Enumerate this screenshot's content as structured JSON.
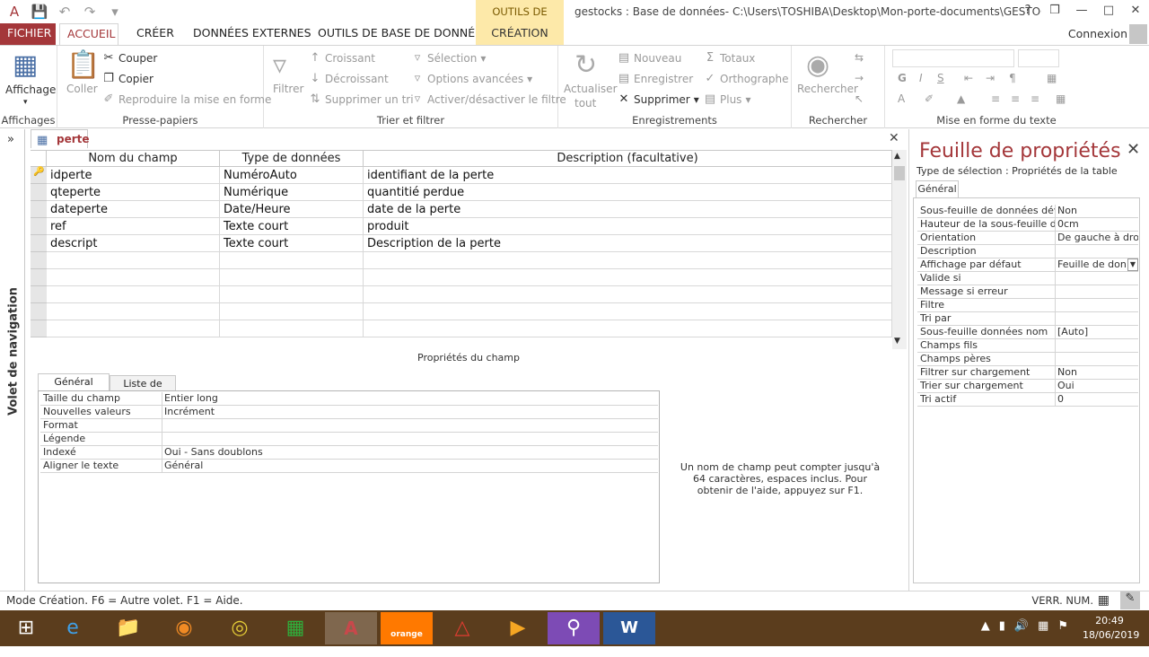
{
  "titlebar": {
    "context_header": "OUTILS DE TABLE",
    "window_title": "gestocks : Base de données- C:\\Users\\TOSHIBA\\Desktop\\Mon-porte-documents\\GESTOCK\\ge...",
    "help": "?",
    "restore": "❒",
    "minimize": "—",
    "maximize": "□",
    "close": "✕"
  },
  "tabs": {
    "file": "FICHIER",
    "accueil": "ACCUEIL",
    "creer": "CRÉER",
    "donnees_externes": "DONNÉES EXTERNES",
    "outils_bd": "OUTILS DE BASE DE DONNÉES",
    "creation": "CRÉATION",
    "connexion": "Connexion"
  },
  "ribbon": {
    "affichage": {
      "label": "Affichage",
      "group": "Affichages"
    },
    "clipboard": {
      "coller": "Coller",
      "couper": "Couper",
      "copier": "Copier",
      "reproduire": "Reproduire la mise en forme",
      "group": "Presse-papiers"
    },
    "sort": {
      "filtrer": "Filtrer",
      "croissant": "Croissant",
      "decroissant": "Décroissant",
      "supprimer_tri": "Supprimer un tri",
      "selection": "Sélection",
      "options": "Options avancées",
      "activer": "Activer/désactiver le filtre",
      "group": "Trier et filtrer"
    },
    "records": {
      "actualiser": "Actualiser",
      "tout": "tout",
      "nouveau": "Nouveau",
      "enregistrer": "Enregistrer",
      "supprimer": "Supprimer",
      "totaux": "Totaux",
      "orthographe": "Orthographe",
      "plus": "Plus",
      "group": "Enregistrements"
    },
    "find": {
      "rechercher": "Rechercher",
      "group": "Rechercher"
    },
    "text": {
      "group": "Mise en forme du texte",
      "bold": "G",
      "italic": "I",
      "underline": "S"
    }
  },
  "nav": {
    "label": "Volet de navigation",
    "toggle": "»"
  },
  "document": {
    "tab_label": "perte",
    "close": "✕",
    "headers": [
      "Nom du champ",
      "Type de données",
      "Description (facultative)"
    ],
    "rows": [
      {
        "name": "idperte",
        "type": "NuméroAuto",
        "desc": "identifiant de la perte"
      },
      {
        "name": "qteperte",
        "type": "Numérique",
        "desc": "quantitié perdue"
      },
      {
        "name": "dateperte",
        "type": "Date/Heure",
        "desc": "date de la perte"
      },
      {
        "name": "ref",
        "type": "Texte court",
        "desc": "produit"
      },
      {
        "name": "descript",
        "type": "Texte court",
        "desc": "Description de la perte"
      }
    ]
  },
  "field_props": {
    "title": "Propriétés du champ",
    "tab_general": "Général",
    "tab_lookup": "Liste de choix",
    "rows": [
      {
        "label": "Taille du champ",
        "value": "Entier long"
      },
      {
        "label": "Nouvelles valeurs",
        "value": "Incrément"
      },
      {
        "label": "Format",
        "value": ""
      },
      {
        "label": "Légende",
        "value": ""
      },
      {
        "label": "Indexé",
        "value": "Oui - Sans doublons"
      },
      {
        "label": "Aligner le texte",
        "value": "Général"
      }
    ],
    "help": "Un nom de champ peut compter jusqu'à 64 caractères, espaces inclus. Pour obtenir de l'aide, appuyez sur F1."
  },
  "property_sheet": {
    "title": "Feuille de propriétés",
    "close": "✕",
    "selection_type": "Type de sélection :  Propriétés de la table",
    "tab": "Général",
    "rows": [
      {
        "label": "Sous-feuille de données développée",
        "value": "Non"
      },
      {
        "label": "Hauteur de la sous-feuille de données",
        "value": "0cm"
      },
      {
        "label": "Orientation",
        "value": "De gauche à droite"
      },
      {
        "label": "Description",
        "value": ""
      },
      {
        "label": "Affichage par défaut",
        "value": "Feuille de données"
      },
      {
        "label": "Valide si",
        "value": ""
      },
      {
        "label": "Message si erreur",
        "value": ""
      },
      {
        "label": "Filtre",
        "value": ""
      },
      {
        "label": "Tri par",
        "value": ""
      },
      {
        "label": "Sous-feuille données nom",
        "value": "[Auto]"
      },
      {
        "label": "Champs fils",
        "value": ""
      },
      {
        "label": "Champs pères",
        "value": ""
      },
      {
        "label": "Filtrer sur chargement",
        "value": "Non"
      },
      {
        "label": "Trier sur chargement",
        "value": "Oui"
      },
      {
        "label": "Tri actif",
        "value": "0"
      }
    ]
  },
  "status": {
    "left": "Mode Création. F6 = Autre volet. F1 = Aide.",
    "right": "VERR. NUM."
  },
  "taskbar": {
    "time": "20:49",
    "date": "18/06/2019",
    "orange": "orange"
  },
  "colors": {
    "accent": "#a4373a",
    "context": "#fde9a9",
    "taskbar": "#5b3d1d"
  }
}
